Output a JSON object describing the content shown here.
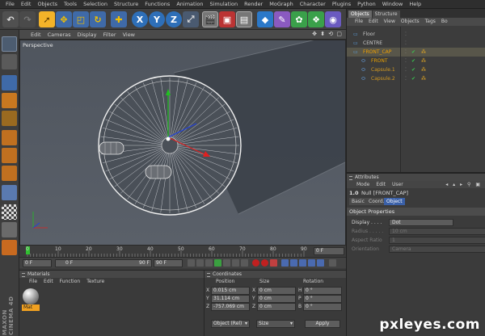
{
  "menubar": [
    "File",
    "Edit",
    "Objects",
    "Tools",
    "Selection",
    "Structure",
    "Functions",
    "Animation",
    "Simulation",
    "Render",
    "MoGraph",
    "Character",
    "Plugins",
    "Python",
    "Window",
    "Help"
  ],
  "toolbar": {
    "icons": [
      "undo-icon",
      "redo-icon",
      "live-selection-icon",
      "move-icon",
      "scale-icon",
      "rotate-icon",
      "add-icon",
      "x-axis-icon",
      "y-axis-icon",
      "z-axis-icon",
      "coordinate-system-icon",
      "render-view-icon",
      "render-picture-viewer-icon",
      "edit-render-settings-icon",
      "cube-icon",
      "pen-spline-icon",
      "subdivision-icon",
      "array-icon",
      "deformer-icon",
      "scene-icon",
      "camera-icon",
      "light-icon"
    ],
    "axis_labels": [
      "X",
      "Y",
      "Z"
    ]
  },
  "viewport": {
    "menu": [
      "Edit",
      "Cameras",
      "Display",
      "Filter",
      "View"
    ],
    "nav_icons": "✥ ⬍ ⟲ ▢",
    "label": "Perspective"
  },
  "timeline": {
    "ticks": [
      "0",
      "10",
      "20",
      "30",
      "40",
      "50",
      "60",
      "70",
      "80",
      "90"
    ],
    "current_frame": "0 F",
    "start_frame": "0 F",
    "range_start": "0 F",
    "range_end": "90 F",
    "end_frame": "90 F"
  },
  "materials": {
    "title": "Materials",
    "menu": [
      "File",
      "Edit",
      "Function",
      "Texture"
    ],
    "items": [
      {
        "name": "Mat"
      }
    ]
  },
  "coordinates": {
    "title": "Coordinates",
    "headers": [
      "Position",
      "Size",
      "Rotation"
    ],
    "rows": [
      {
        "axis": "X",
        "pos": "0.015 cm",
        "size_axis": "X",
        "size": "0 cm",
        "rot_axis": "H",
        "rot": "0 °"
      },
      {
        "axis": "Y",
        "pos": "31.114 cm",
        "size_axis": "Y",
        "size": "0 cm",
        "rot_axis": "P",
        "rot": "0 °"
      },
      {
        "axis": "Z",
        "pos": "-757.069 cm",
        "size_axis": "Z",
        "size": "0 cm",
        "rot_axis": "B",
        "rot": "0 °"
      }
    ],
    "mode_select": "Object (Rel)",
    "size_select": "Size",
    "apply_label": "Apply"
  },
  "objects": {
    "tabs": [
      "Objects",
      "Structure"
    ],
    "menu": [
      "File",
      "Edit",
      "View",
      "Objects",
      "Tags",
      "Bo"
    ],
    "items": [
      {
        "name": "Floor",
        "indent": 0,
        "color": "#c8c8c8"
      },
      {
        "name": "CENTRE",
        "indent": 0,
        "color": "#c8c8c8"
      },
      {
        "name": "FRONT_CAP",
        "indent": 0,
        "color": "#f0a000",
        "selected": true
      },
      {
        "name": "FRONT",
        "indent": 1,
        "color": "#e8a000"
      },
      {
        "name": "Capsule.1",
        "indent": 1,
        "color": "#d49a20"
      },
      {
        "name": "Capsule.2",
        "indent": 1,
        "color": "#d49a20"
      }
    ]
  },
  "attributes": {
    "title": "Attributes",
    "menu": [
      "Mode",
      "Edit",
      "User"
    ],
    "object_label": "Null [FRONT_CAP]",
    "tabs": [
      "Basic",
      "Coord.",
      "Object"
    ],
    "section": "Object Properties",
    "fields": [
      {
        "label": "Display . . . .",
        "value": "Dot"
      },
      {
        "label": "Radius . . . . .",
        "value": "10 cm"
      },
      {
        "label": "Aspect Ratio",
        "value": "1"
      },
      {
        "label": "Orientation",
        "value": "Camera"
      }
    ]
  },
  "watermark": "pxleyes.com",
  "side_brand": "MAXON CINEMA 4D"
}
